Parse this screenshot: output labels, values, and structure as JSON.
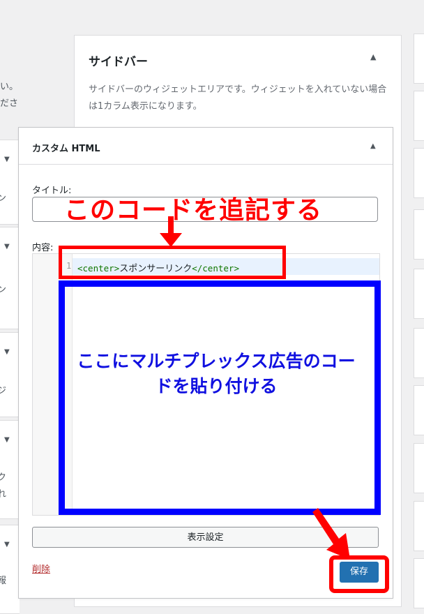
{
  "left_fragments": [
    "い。",
    "ださ",
    "ン",
    "ン",
    "ジ",
    "ク",
    "れ",
    "報"
  ],
  "sidebar": {
    "title": "サイドバー",
    "description": "サイドバーのウィジェットエリアです。ウィジェットを入れていない場合は1カラム表示になります。"
  },
  "widget": {
    "title": "カスタム HTML",
    "title_label": "タイトル:",
    "title_value": "",
    "content_label": "内容:",
    "line_number": "1",
    "code": {
      "open_tag": "<center>",
      "text": "スポンサーリンク",
      "close_tag": "</center>"
    },
    "display_settings_label": "表示設定",
    "delete_label": "削除",
    "save_label": "保存"
  },
  "annotations": {
    "red_text": "このコードを追記する",
    "blue_text": "ここにマルチプレックス広告のコードを貼り付ける",
    "red_color": "#ff0000",
    "blue_color": "#0000ff"
  },
  "icons": {
    "collapse": "caret-up-icon",
    "expand": "caret-down-icon"
  },
  "colors": {
    "primary_button": "#2271b1",
    "delete_link": "#b32d2e",
    "code_tag": "#117700",
    "active_line": "#e8f2fe"
  }
}
